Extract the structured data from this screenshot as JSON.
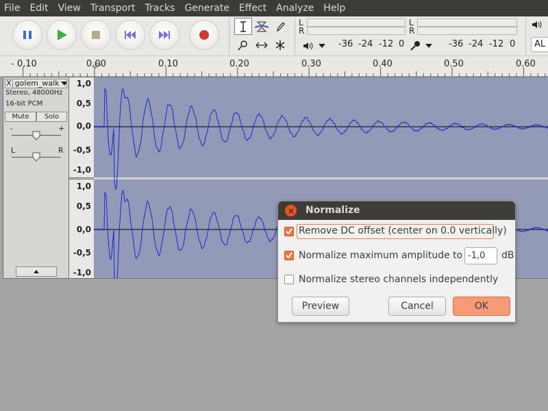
{
  "menu": [
    "File",
    "Edit",
    "View",
    "Transport",
    "Tracks",
    "Generate",
    "Effect",
    "Analyze",
    "Help"
  ],
  "meters": {
    "left_channel": "L",
    "right_channel": "R",
    "scale": [
      "-36",
      "-24",
      "-12",
      "0"
    ],
    "record_scale": [
      "-36",
      "-24",
      "-12",
      "0"
    ],
    "device_partial": "AL"
  },
  "ruler": {
    "labels": [
      "- 0,10",
      "0,00",
      "0.10",
      "0.20",
      "0.30",
      "0.40",
      "0.50",
      "0.60"
    ]
  },
  "track": {
    "name": "golem_walk",
    "info1": "Stereo, 48000Hz",
    "info2": "16-bit PCM",
    "mute": "Mute",
    "solo": "Solo",
    "gain_minus": "-",
    "gain_plus": "+",
    "pan_left": "L",
    "pan_right": "R",
    "close": "X"
  },
  "vruler": {
    "top": [
      "1,0",
      "0,5",
      "0,0",
      "-0,5",
      "-1,0"
    ],
    "bottom": [
      "1,0",
      "0,5",
      "0,0",
      "-0,5",
      "-1,0"
    ]
  },
  "dialog": {
    "title": "Normalize",
    "option_dc": "Remove DC offset (center on 0.0 vertically)",
    "option_dc_checked": true,
    "option_amp": "Normalize maximum amplitude to",
    "option_amp_checked": true,
    "amp_value": "-1,0",
    "amp_unit": "dB",
    "option_stereo": "Normalize stereo channels independently",
    "option_stereo_checked": false,
    "preview": "Preview",
    "cancel": "Cancel",
    "ok": "OK"
  },
  "colors": {
    "waveform": "#2222cc",
    "wave_bg": "#929ab8",
    "accent": "#f07746",
    "menubar": "#3c3b37"
  }
}
